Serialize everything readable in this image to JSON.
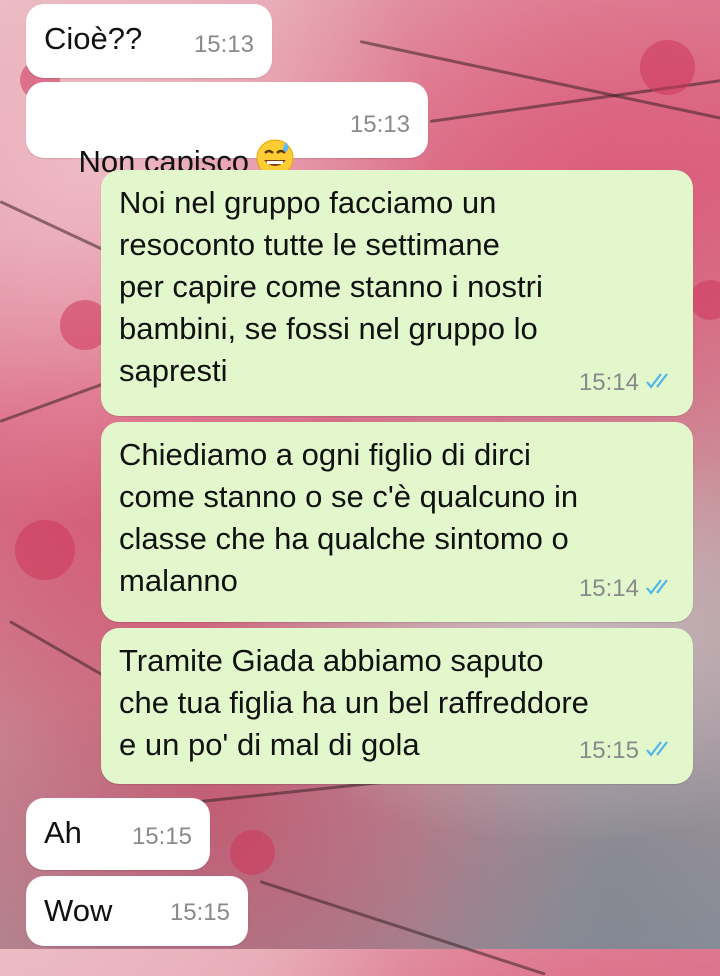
{
  "chat": {
    "messages": [
      {
        "direction": "in",
        "text": "Cioè??",
        "time": "15:13"
      },
      {
        "direction": "in",
        "text": "Non capisco",
        "emoji": "sweat-smile",
        "time": "15:13"
      },
      {
        "direction": "out",
        "text": "Noi nel gruppo facciamo un\nresoconto tutte le settimane\nper capire come stanno i nostri\nbambini, se fossi nel gruppo lo\nsapresti",
        "time": "15:14",
        "status": "read"
      },
      {
        "direction": "out",
        "text": "Chiediamo a ogni figlio di dirci\ncome stanno o se c'è qualcuno in\nclasse che ha qualche sintomo o\nmalanno",
        "time": "15:14",
        "status": "read"
      },
      {
        "direction": "out",
        "text": "Tramite Giada abbiamo saputo\nche tua figlia ha un bel raffreddore\ne un po' di mal di gola",
        "time": "15:15",
        "status": "read"
      },
      {
        "direction": "in",
        "text": "Ah",
        "time": "15:15"
      },
      {
        "direction": "in",
        "text": "Wow",
        "time": "15:15"
      }
    ]
  },
  "colors": {
    "incoming_bubble": "#ffffff",
    "outgoing_bubble": "#e2f7cb",
    "read_ticks": "#4fb6ec",
    "timestamp": "#8a8a8a"
  }
}
